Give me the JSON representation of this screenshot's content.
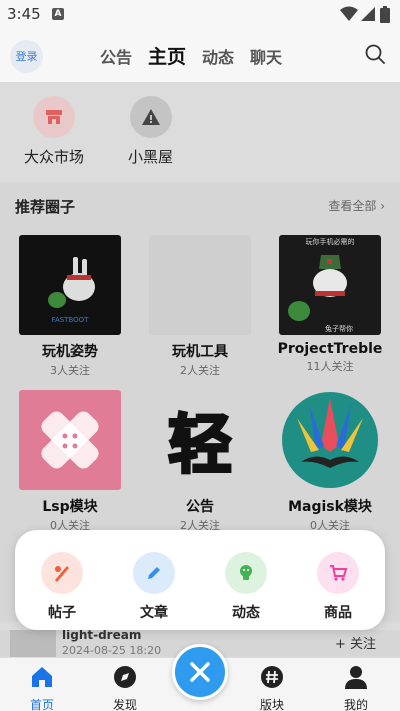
{
  "status": {
    "time": "3:45",
    "notif_glyph": "A"
  },
  "header": {
    "login": "登录",
    "tabs": [
      "公告",
      "主页",
      "动态",
      "聊天"
    ],
    "active_tab": "主页"
  },
  "quick": [
    {
      "label": "大众市场",
      "icon": "store-icon"
    },
    {
      "label": "小黑屋",
      "icon": "warning-icon"
    }
  ],
  "circles": {
    "title": "推荐圈子",
    "more": "查看全部",
    "items": [
      {
        "name": "玩机姿势",
        "sub": "3人关注",
        "img_text": "FASTBOOT"
      },
      {
        "name": "玩机工具",
        "sub": "2人关注"
      },
      {
        "name": "ProjectTreble",
        "sub": "11人关注",
        "img_top": "玩你手机必需的",
        "img_bottom": "兔子帮你"
      },
      {
        "name": "Lsp模块",
        "sub": "0人关注"
      },
      {
        "name": "公告",
        "sub": "2人关注",
        "img_text": "轻"
      },
      {
        "name": "Magisk模块",
        "sub": "0人关注"
      }
    ]
  },
  "sheet": {
    "actions": [
      {
        "label": "帖子",
        "icon": "post-icon",
        "bg": "#fde3dd",
        "fg": "#f0603c"
      },
      {
        "label": "文章",
        "icon": "pencil-icon",
        "bg": "#dcebfb",
        "fg": "#2e8ff0"
      },
      {
        "label": "动态",
        "icon": "bulb-icon",
        "bg": "#def3df",
        "fg": "#45b255"
      },
      {
        "label": "商品",
        "icon": "cart-icon",
        "bg": "#fde0ef",
        "fg": "#f0409a"
      }
    ]
  },
  "peek": {
    "username": "light-dream",
    "date": "2024-08-25 18:20",
    "follow": "+ 关注"
  },
  "nav": {
    "items": [
      {
        "label": "首页",
        "icon": "home-icon"
      },
      {
        "label": "发现",
        "icon": "compass-icon"
      },
      {
        "label": "版块",
        "icon": "hashtag-icon"
      },
      {
        "label": "我的",
        "icon": "user-icon"
      }
    ],
    "active": "首页",
    "accent": "#2e9bef"
  }
}
